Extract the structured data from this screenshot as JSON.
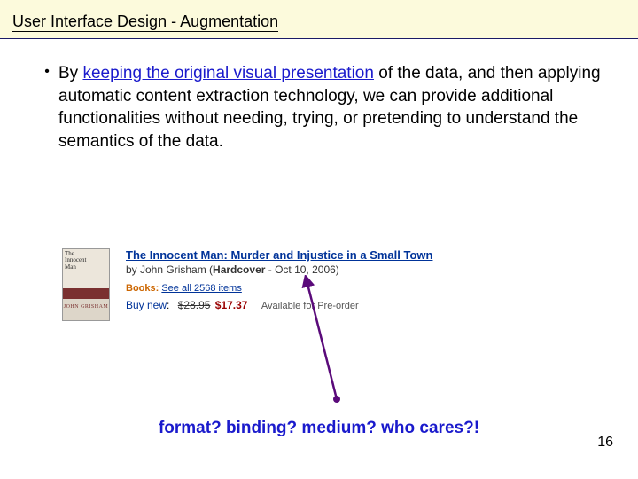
{
  "slide": {
    "title": "User Interface Design - Augmentation",
    "number": "16",
    "caption": "format? binding? medium? who cares?!"
  },
  "bullet": {
    "lead": "By ",
    "highlight": "keeping the original visual presentation",
    "rest": " of the data, and then applying automatic content extraction technology, we can provide additional functionalities without needing, trying, or pretending to understand the semantics of the data."
  },
  "cover": {
    "line1": "The",
    "line2": "Innocent",
    "line3": "Man",
    "author": "JOHN GRISHAM"
  },
  "product": {
    "title": "The Innocent Man: Murder and Injustice in a Small Town",
    "by_prefix": "by John Grisham (",
    "format": "Hardcover",
    "date": " - Oct 10, 2006)",
    "books_label": "Books:",
    "books_link": "See all 2568 items",
    "buy_label": "Buy new",
    "colon": ":",
    "old_price": "$28.95",
    "sale_price": "$17.37",
    "availability": "Available for Pre-order"
  }
}
